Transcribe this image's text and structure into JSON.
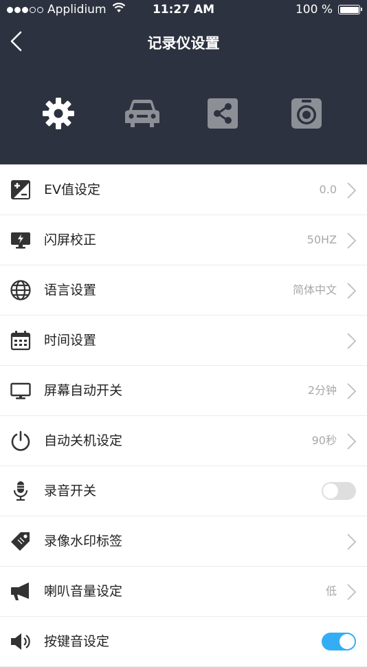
{
  "status_bar": {
    "carrier": "Applidium",
    "time": "11:27 AM",
    "battery": "100 %",
    "signal_dots_filled": 3,
    "signal_dots_total": 5
  },
  "nav": {
    "title": "记录仪设置"
  },
  "tabs": [
    {
      "icon": "gear-icon",
      "active": true
    },
    {
      "icon": "car-icon",
      "active": false
    },
    {
      "icon": "share-icon",
      "active": false
    },
    {
      "icon": "camera-icon",
      "active": false
    }
  ],
  "colors": {
    "header_bg": "#2d3240",
    "toggle_on": "#33aef5",
    "inactive_tab": "#8c8f96"
  },
  "settings": [
    {
      "icon": "exposure-icon",
      "label": "EV值设定",
      "value": "0.0"
    },
    {
      "icon": "flicker-monitor-icon",
      "label": "闪屏校正",
      "value": "50HZ"
    },
    {
      "icon": "globe-icon",
      "label": "语言设置",
      "value": "简体中文"
    },
    {
      "icon": "calendar-icon",
      "label": "时间设置",
      "value": ""
    },
    {
      "icon": "monitor-icon",
      "label": "屏幕自动开关",
      "value": "2分钟"
    },
    {
      "icon": "power-icon",
      "label": "自动关机设定",
      "value": "90秒"
    },
    {
      "icon": "microphone-icon",
      "label": "录音开关",
      "toggle": false
    },
    {
      "icon": "tag-icon",
      "label": "录像水印标签",
      "value": ""
    },
    {
      "icon": "megaphone-icon",
      "label": "喇叭音量设定",
      "value": "低"
    },
    {
      "icon": "speaker-icon",
      "label": "按键音设定",
      "toggle": true
    }
  ]
}
